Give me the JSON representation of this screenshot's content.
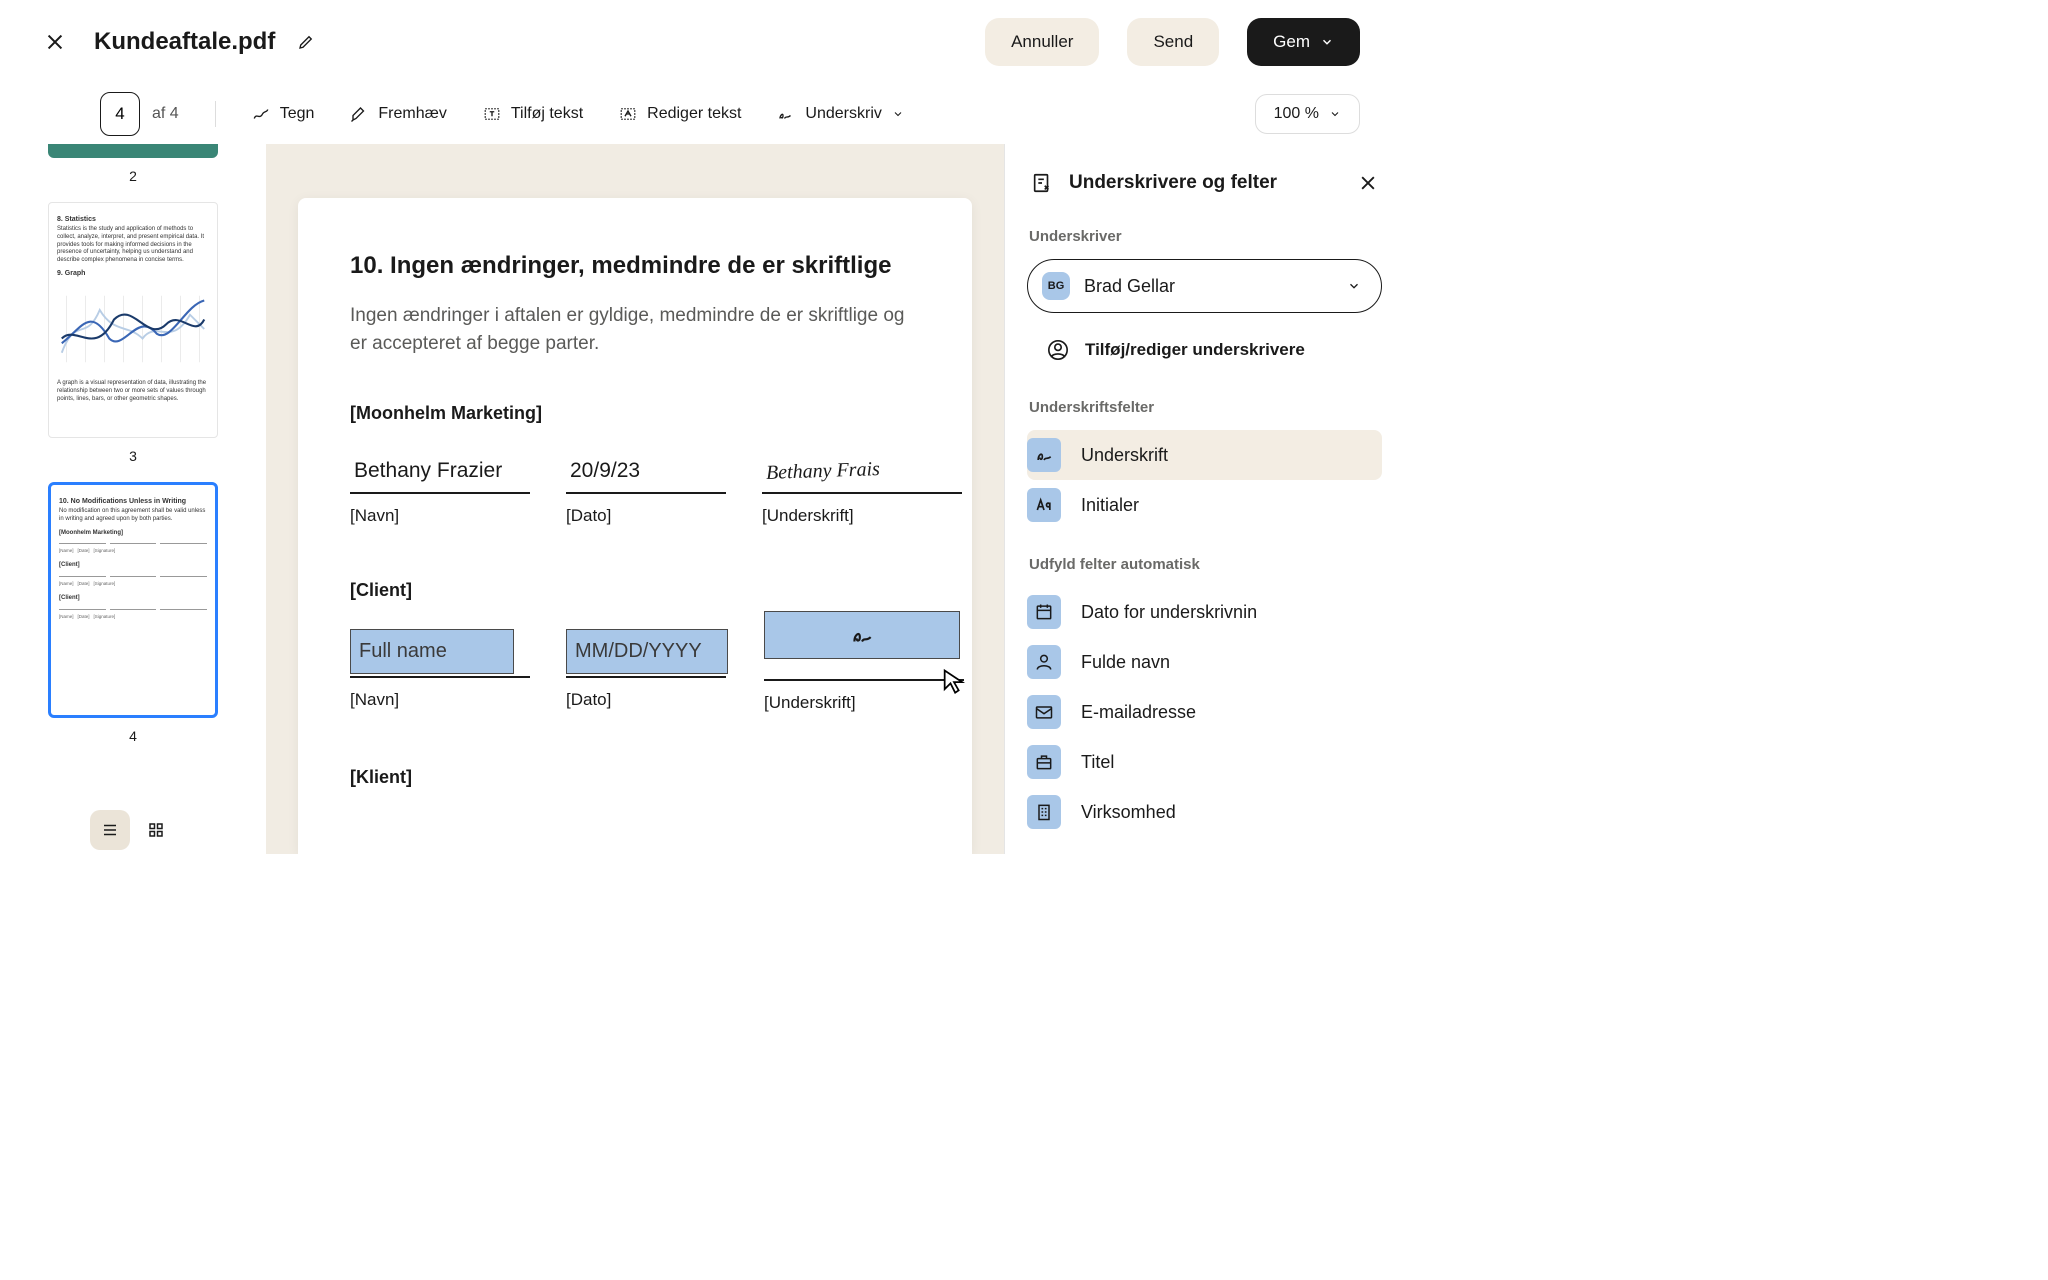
{
  "header": {
    "title": "Kundeaftale.pdf",
    "cancel": "Annuller",
    "send": "Send",
    "save": "Gem"
  },
  "toolbar": {
    "page_current": "4",
    "page_total": "af 4",
    "draw": "Tegn",
    "highlight": "Fremhæv",
    "add_text": "Tilføj tekst",
    "edit_text": "Rediger tekst",
    "sign": "Underskriv",
    "zoom": "100 %"
  },
  "thumbs": {
    "n2": "2",
    "n3": "3",
    "n4": "4",
    "t3_heading1": "8. Statistics",
    "t3_body1": "Statistics is the study and application of methods to collect, analyze, interpret, and present empirical data. It provides tools for making informed decisions in the presence of uncertainty, helping us understand and describe complex phenomena in concise terms.",
    "t3_heading2": "9. Graph",
    "t3_caption": "A graph is a visual representation of data, illustrating the relationship between two or more sets of values through points, lines, bars, or other geometric shapes.",
    "t4_heading": "10. No Modifications Unless in Writing",
    "t4_body": "No modification on this agreement shall be valid unless in writing and agreed upon by both parties.",
    "t4_party1": "[Moonhelm Marketing]",
    "t4_party2": "[Client]",
    "t4_name": "[Name]",
    "t4_date": "[Date]",
    "t4_sig": "[Signature]"
  },
  "doc": {
    "heading": "10. Ingen ændringer, medmindre de er skriftlige",
    "body": "Ingen ændringer i aftalen er gyldige, medmindre de er skriftlige og er accepteret af begge parter.",
    "party1": "[Moonhelm Marketing]",
    "party1_name": "Bethany Frazier",
    "party1_date": "20/9/23",
    "party1_sig": "Bethany Frais",
    "label_name": "[Navn]",
    "label_date": "[Dato]",
    "label_sig": "[Underskrift]",
    "party2": "[Client]",
    "party2_name_ph": "Full name",
    "party2_date_ph": "MM/DD/YYYY",
    "party3": "[Klient]"
  },
  "panel": {
    "title": "Underskrivere og felter",
    "section_signer": "Underskriver",
    "signer_initials": "BG",
    "signer_name": "Brad Gellar",
    "add_signer": "Tilføj/rediger underskrivere",
    "section_sigfields": "Underskriftsfelter",
    "f_signature": "Underskrift",
    "f_initials": "Initialer",
    "section_autofill": "Udfyld felter automatisk",
    "f_date": "Dato for underskrivnin",
    "f_fullname": "Fulde navn",
    "f_email": "E-mailadresse",
    "f_title": "Titel",
    "f_company": "Virksomhed"
  }
}
